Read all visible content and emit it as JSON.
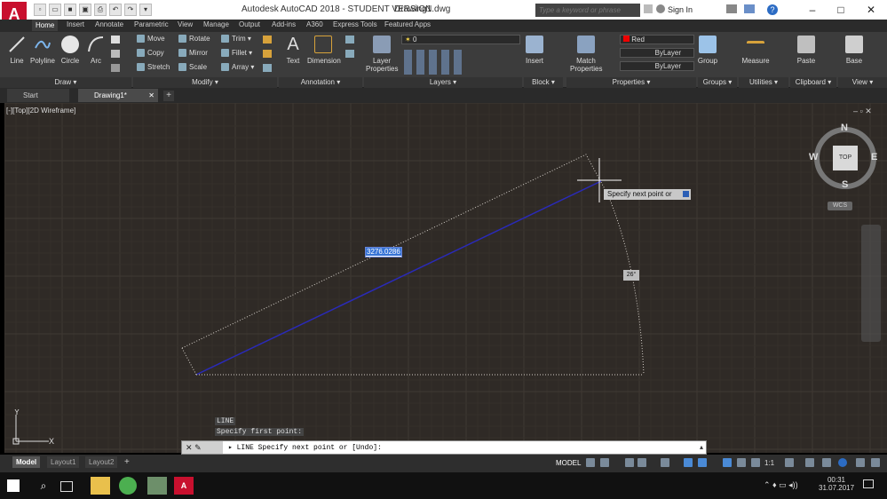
{
  "app": {
    "logo_letter": "A",
    "title": "Autodesk AutoCAD 2018 - STUDENT VERSION",
    "file": "Drawing1.dwg",
    "search_placeholder": "Type a keyword or phrase",
    "signin": "Sign In"
  },
  "ribbon_tabs": [
    "Home",
    "Insert",
    "Annotate",
    "Parametric",
    "View",
    "Manage",
    "Output",
    "Add-ins",
    "A360",
    "Express Tools",
    "Featured Apps"
  ],
  "ribbon": {
    "draw": {
      "title": "Draw",
      "line": "Line",
      "polyline": "Polyline",
      "circle": "Circle",
      "arc": "Arc"
    },
    "modify": {
      "title": "Modify",
      "move": "Move",
      "rotate": "Rotate",
      "trim": "Trim",
      "copy": "Copy",
      "mirror": "Mirror",
      "fillet": "Fillet",
      "stretch": "Stretch",
      "scale": "Scale",
      "array": "Array"
    },
    "annotation": {
      "title": "Annotation",
      "text": "Text",
      "dimension": "Dimension"
    },
    "layers": {
      "title": "Layers",
      "layer_properties": "Layer Properties",
      "current_layer": "0"
    },
    "block": {
      "title": "Block",
      "insert": "Insert"
    },
    "properties": {
      "title": "Properties",
      "match": "Match Properties",
      "color": "Red",
      "linetype": "ByLayer",
      "lineweight": "ByLayer"
    },
    "groups": {
      "title": "Groups",
      "group": "Group"
    },
    "utilities": {
      "title": "Utilities",
      "measure": "Measure"
    },
    "clipboard": {
      "title": "Clipboard",
      "paste": "Paste"
    },
    "view": {
      "title": "View",
      "base": "Base"
    }
  },
  "doc_tabs": {
    "start": "Start",
    "drawing": "Drawing1*"
  },
  "viewport": {
    "label": "[-][Top][2D Wireframe]",
    "controls": "– ▫ ✕"
  },
  "dynamic_input": {
    "length": "3276.0286",
    "angle": "26°",
    "prompt": "Specify next point or"
  },
  "viewcube": {
    "top": "TOP",
    "n": "N",
    "s": "S",
    "e": "E",
    "w": "W",
    "wcs": "WCS"
  },
  "ucs": {
    "x": "X",
    "y": "Y"
  },
  "command": {
    "history": [
      "LINE",
      "Specify first point:"
    ],
    "current": "LINE Specify next point or [Undo]:"
  },
  "status": {
    "layout_tabs": [
      "Model",
      "Layout1",
      "Layout2"
    ],
    "model_label": "MODEL",
    "scale": "1:1"
  },
  "taskbar": {
    "time": "00:31",
    "date": "31.07.2017"
  }
}
